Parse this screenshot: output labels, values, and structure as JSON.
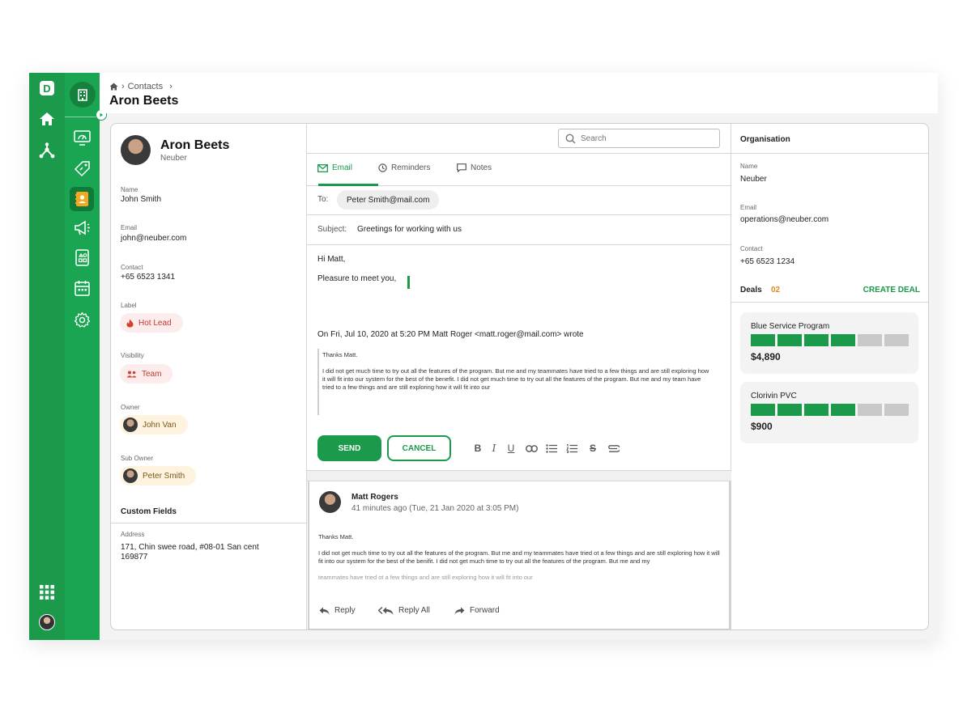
{
  "nav": {
    "logo_letter": "D"
  },
  "header": {
    "breadcrumb": "Contacts",
    "title": "Aron Beets"
  },
  "profile": {
    "name": "Aron Beets",
    "org": "Neuber",
    "fields": {
      "name_label": "Name",
      "name_value": "John Smith",
      "email_label": "Email",
      "email_value": "john@neuber.com",
      "contact_label": "Contact",
      "contact_value": "+65 6523 1341",
      "label_label": "Label",
      "label_value": "Hot Lead",
      "visibility_label": "Visibility",
      "visibility_value": "Team",
      "owner_label": "Owner",
      "owner_value": "John Van",
      "subowner_label": "Sub Owner",
      "subowner_value": "Peter Smith"
    },
    "custom_fields_title": "Custom Fields",
    "address_label": "Address",
    "address_line1": "171, Chin swee road, #08-01 San cent",
    "address_line2": "169877"
  },
  "composer": {
    "search_placeholder": "Search",
    "tabs": [
      "Email",
      "Reminders",
      "Notes"
    ],
    "to_label": "To:",
    "to_value": "Peter Smith@mail.com",
    "subject_label": "Subject:",
    "subject_value": "Greetings for working with us",
    "body_greeting": "Hi Matt,",
    "body_line": "Pleasure to meet you,",
    "quote_header": "On Fri, Jul 10, 2020 at 5:20 PM Matt Roger <matt.roger@mail.com> wrote",
    "quote_line1": "Thanks Matt.",
    "quote_line2": "I did not get much time to try out all the features of the program. But me and my teammates have tried to a few things and are still exploring how it will fit into our system  for the best of the benefit. I did not get much time to try out all the features of the program. But me and my team have tried to a few things and are still exploring how it will fit into our",
    "send_label": "SEND",
    "cancel_label": "CANCEL"
  },
  "thread": {
    "author": "Matt Rogers",
    "time": "41 minutes ago (Tue, 21 Jan 2020 at 3:05 PM)",
    "line1": "Thanks Matt.",
    "line2": "I did not get much time to try out all the features of the program. But me and my teammates have tried ot a few things and are still exploring how it will fit into our system for the best of the benifit. I did not get much time to try out all the features of the program. But me and my",
    "line3": "teammates have tried ot a few things and are still exploring how it will fit into our",
    "reply": "Reply",
    "reply_all": "Reply All",
    "forward": "Forward"
  },
  "organisation": {
    "title": "Organisation",
    "name_label": "Name",
    "name_value": "Neuber",
    "email_label": "Email",
    "email_value": "operations@neuber.com",
    "contact_label": "Contact",
    "contact_value": "+65 6523 1234",
    "deals_title": "Deals",
    "deals_count": "02",
    "create_deal": "CREATE DEAL",
    "deals": [
      {
        "name": "Blue Service Program",
        "amount": "$4,890",
        "stage": 4,
        "stages": 6
      },
      {
        "name": "Clorivin PVC",
        "amount": "$900",
        "stage": 4,
        "stages": 6
      }
    ]
  },
  "colors": {
    "brand": "#1a9a4a",
    "accent_orange": "#e48a1a"
  }
}
